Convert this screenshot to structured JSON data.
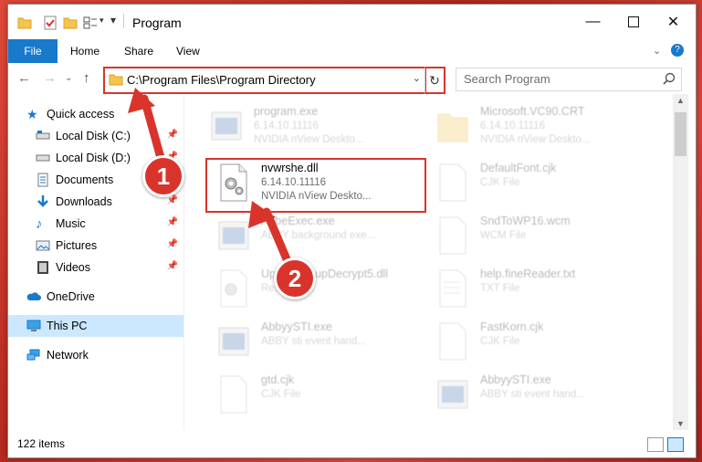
{
  "window": {
    "title": "Program",
    "status_count": "122 items"
  },
  "ribbon": {
    "tabs": [
      "File",
      "Home",
      "Share",
      "View"
    ]
  },
  "address": {
    "path": "C:\\Program Files\\Program Directory",
    "search_placeholder": "Search Program"
  },
  "sidebar": {
    "items": [
      {
        "label": "Quick access",
        "icon": "star-icon"
      },
      {
        "label": "Local Disk (C:)",
        "icon": "drive-icon"
      },
      {
        "label": "Local Disk (D:)",
        "icon": "drive-icon"
      },
      {
        "label": "Documents",
        "icon": "documents-icon"
      },
      {
        "label": "Downloads",
        "icon": "download-icon"
      },
      {
        "label": "Music",
        "icon": "music-icon"
      },
      {
        "label": "Pictures",
        "icon": "pictures-icon"
      },
      {
        "label": "Videos",
        "icon": "videos-icon"
      },
      {
        "label": "OneDrive",
        "icon": "cloud-icon"
      },
      {
        "label": "This PC",
        "icon": "computer-icon"
      },
      {
        "label": "Network",
        "icon": "network-icon"
      }
    ]
  },
  "files": [
    {
      "name": "program.exe",
      "line2": "6.14.10.11116",
      "line3": "NVIDIA nView Deskto..."
    },
    {
      "name": "Microsoft.VC90.CRT",
      "line2": "6.14.10.11116",
      "line3": "NVIDIA nView Deskto..."
    },
    {
      "name": "nvwrshe.dll",
      "line2": "6.14.10.11116",
      "line3": "NVIDIA nView Deskto..."
    },
    {
      "name": "DefaultFont.cjk",
      "line2": "CJK File",
      "line3": ""
    },
    {
      "name": "AbbeExec.exe",
      "line2": "ABBY background exe...",
      "line3": ""
    },
    {
      "name": "SndToWP16.wcm",
      "line2": "WCM File",
      "line3": ""
    },
    {
      "name": "UpdateSetupDecrypt5.dll",
      "line2": "Resource...",
      "line3": ""
    },
    {
      "name": "help.fineReader.txt",
      "line2": "TXT File",
      "line3": ""
    },
    {
      "name": "AbbyySTI.exe",
      "line2": "ABBY sti event hand...",
      "line3": ""
    },
    {
      "name": "FastKorn.cjk",
      "line2": "CJK File",
      "line3": ""
    },
    {
      "name": "gtd.cjk",
      "line2": "CJK File",
      "line3": ""
    },
    {
      "name": "AbbyySTI.exe",
      "line2": "ABBY sti event hand...",
      "line3": ""
    }
  ],
  "callouts": [
    "1",
    "2"
  ],
  "colors": {
    "accent": "#1979ca",
    "highlight": "#d9342b",
    "selected": "#cce8ff"
  }
}
